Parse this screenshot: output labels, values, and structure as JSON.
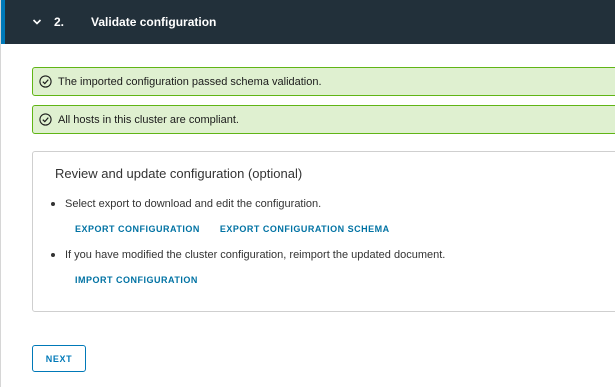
{
  "step": {
    "number": "2.",
    "title": "Validate configuration",
    "expanded": true
  },
  "alerts": [
    {
      "text": "The imported configuration passed schema validation.",
      "status": "success",
      "icon": "check-circle-icon"
    },
    {
      "text": "All hosts in this cluster are compliant.",
      "status": "success",
      "icon": "check-circle-icon"
    }
  ],
  "review": {
    "title": "Review and update configuration (optional)",
    "items": [
      {
        "text": "Select export to download and edit the configuration.",
        "links": [
          "EXPORT CONFIGURATION",
          "EXPORT CONFIGURATION SCHEMA"
        ]
      },
      {
        "text": "If you have modified the cluster configuration, reimport the updated document.",
        "links": [
          "IMPORT CONFIGURATION"
        ]
      }
    ]
  },
  "footer": {
    "next_label": "NEXT"
  },
  "colors": {
    "header_bg": "#22303a",
    "accent": "#0079b8",
    "success_bg": "#dff0d0",
    "success_border": "#60b515"
  }
}
